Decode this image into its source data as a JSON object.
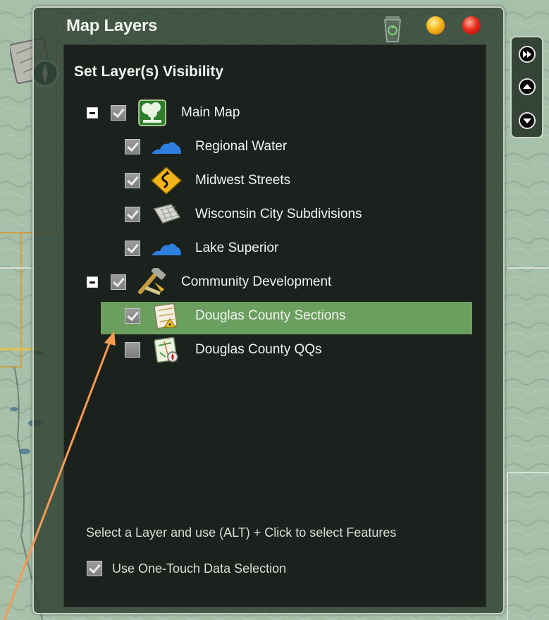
{
  "panel": {
    "title": "Map Layers"
  },
  "layers": {
    "heading": "Set Layer(s) Visibility",
    "groups": [
      {
        "label": "Main Map",
        "checked": true,
        "expanded": true,
        "icon": "main-map-icon",
        "children": [
          {
            "label": "Regional Water",
            "checked": true,
            "icon": "water-icon"
          },
          {
            "label": "Midwest Streets",
            "checked": true,
            "icon": "street-sign-icon"
          },
          {
            "label": "Wisconsin City Subdivisions",
            "checked": true,
            "icon": "parcel-map-icon"
          },
          {
            "label": "Lake Superior",
            "checked": true,
            "icon": "water-icon"
          }
        ]
      },
      {
        "label": "Community Development",
        "checked": true,
        "expanded": true,
        "icon": "development-icon",
        "children": [
          {
            "label": "Douglas County Sections",
            "checked": true,
            "selected": true,
            "icon": "sections-map-icon"
          },
          {
            "label": "Douglas County QQs",
            "checked": false,
            "icon": "qq-map-icon"
          }
        ]
      }
    ]
  },
  "footer": {
    "hint": "Select a Layer and use (ALT) + Click to select Features",
    "one_touch_label": "Use One-Touch Data Selection",
    "one_touch_checked": true
  },
  "colors": {
    "panel_bg": "#2d3e30",
    "content_bg": "#1b211c",
    "selected_row": "#6a9f5f",
    "annotation_arrow": "#f59a52",
    "minimize": "#f6b51a",
    "close": "#e82a1a"
  },
  "icons": {
    "tool": "compass-map-icon",
    "recycle": "recycle-bin-icon",
    "nav": [
      "fast-forward-icon",
      "arrow-up-icon",
      "arrow-down-icon"
    ]
  }
}
